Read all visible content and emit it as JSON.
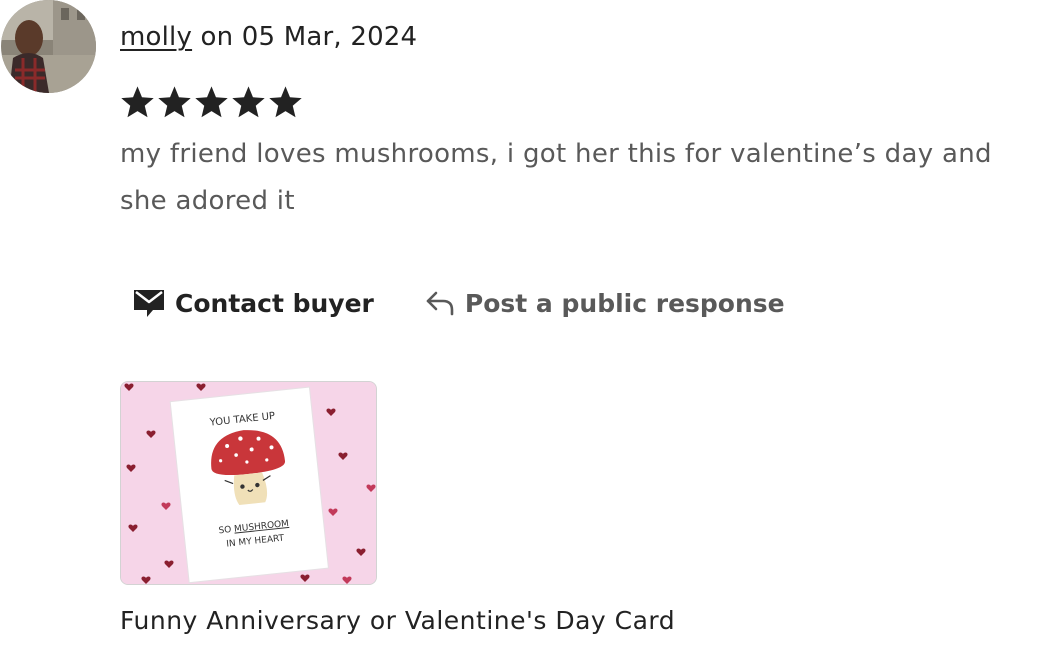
{
  "review": {
    "reviewer_name": "molly",
    "date_text": " on 05 Mar, 2024",
    "rating": 5,
    "rating_max": 5,
    "text": "my friend loves mushrooms, i got her this for valentine’s day and she adored it"
  },
  "actions": {
    "contact_label": "Contact buyer",
    "respond_label": "Post a public response"
  },
  "product": {
    "title": "Funny Anniversary or Valentine's Day Card",
    "card_top_text": "YOU TAKE UP",
    "card_bottom_prefix": "SO ",
    "card_bottom_underlined": "MUSHROOM",
    "card_bottom_line2": "IN MY HEART"
  },
  "colors": {
    "text_primary": "#222222",
    "text_secondary": "#595959",
    "star": "#222222",
    "card_bg": "#f6d5e8",
    "mushroom_cap": "#c9363a"
  },
  "icons": {
    "contact": "envelope-speech-icon",
    "respond": "reply-arrow-icon"
  }
}
